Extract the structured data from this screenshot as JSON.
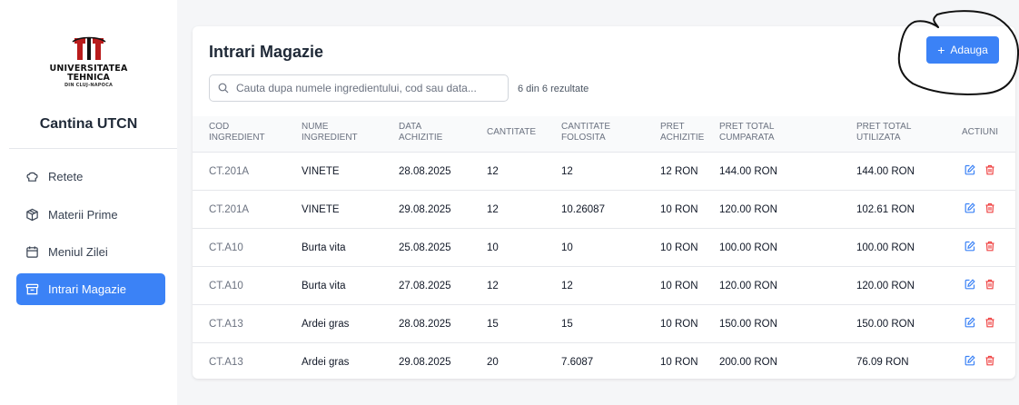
{
  "sidebar": {
    "logo": {
      "line1": "UNIVERSITATEA",
      "line2": "TEHNICA",
      "line3": "DIN CLUJ-NAPOCA",
      "color": "#b91c1c"
    },
    "brand": "Cantina UTCN",
    "items": [
      {
        "label": "Retete",
        "icon": "chef-hat-icon"
      },
      {
        "label": "Materii Prime",
        "icon": "package-icon"
      },
      {
        "label": "Meniul Zilei",
        "icon": "calendar-icon"
      },
      {
        "label": "Intrari Magazie",
        "icon": "archive-icon",
        "active": true
      }
    ]
  },
  "main": {
    "title": "Intrari Magazie",
    "add_button": "Adauga",
    "search_placeholder": "Cauta dupa numele ingredientului, cod sau data...",
    "result_count": "6 din 6 rezultate",
    "columns": [
      "COD\nINGREDIENT",
      "NUME\nINGREDIENT",
      "DATA\nACHIZITIE",
      "CANTITATE",
      "CANTITATE\nFOLOSITA",
      "PRET\nACHIZITIE",
      "PRET TOTAL\nCUMPARATA",
      "PRET TOTAL\nUTILIZATA",
      "ACTIUNI"
    ],
    "rows": [
      [
        "CT.201A",
        "VINETE",
        "28.08.2025",
        "12",
        "12",
        "12 RON",
        "144.00 RON",
        "144.00 RON"
      ],
      [
        "CT.201A",
        "VINETE",
        "29.08.2025",
        "12",
        "10.26087",
        "10 RON",
        "120.00 RON",
        "102.61 RON"
      ],
      [
        "CT.A10",
        "Burta vita",
        "25.08.2025",
        "10",
        "10",
        "10 RON",
        "100.00 RON",
        "100.00 RON"
      ],
      [
        "CT.A10",
        "Burta vita",
        "27.08.2025",
        "12",
        "12",
        "10 RON",
        "120.00 RON",
        "120.00 RON"
      ],
      [
        "CT.A13",
        "Ardei gras",
        "28.08.2025",
        "15",
        "15",
        "10 RON",
        "150.00 RON",
        "150.00 RON"
      ],
      [
        "CT.A13",
        "Ardei gras",
        "29.08.2025",
        "20",
        "7.6087",
        "10 RON",
        "200.00 RON",
        "76.09 RON"
      ]
    ]
  },
  "colors": {
    "accent": "#3b82f6",
    "edit_icon": "#3b82f6",
    "delete_icon": "#ef4444"
  }
}
